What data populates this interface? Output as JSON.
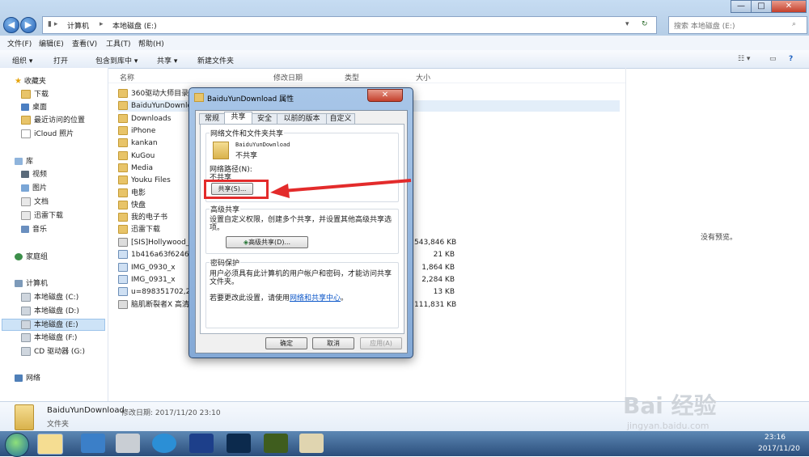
{
  "address": {
    "crumbs": [
      "计算机",
      "本地磁盘 (E:)"
    ],
    "search_placeholder": "搜索 本地磁盘 (E:)"
  },
  "window_controls": {
    "min": "—",
    "max": "□",
    "close": "✕"
  },
  "menu": [
    "文件(F)",
    "编辑(E)",
    "查看(V)",
    "工具(T)",
    "帮助(H)"
  ],
  "toolbar": [
    "组织 ▾",
    "打开",
    "包含到库中 ▾",
    "共享 ▾",
    "新建文件夹"
  ],
  "nav": {
    "favorites_title": "收藏夹",
    "favorites": [
      "下载",
      "桌面",
      "最近访问的位置",
      "iCloud 照片"
    ],
    "library_title": "库",
    "library": [
      "视频",
      "图片",
      "文档",
      "迅雷下载",
      "音乐"
    ],
    "homegroup": "家庭组",
    "computer_title": "计算机",
    "drives": [
      "本地磁盘 (C:)",
      "本地磁盘 (D:)",
      "本地磁盘 (E:)",
      "本地磁盘 (F:)",
      "CD 驱动器 (G:)"
    ],
    "network": "网络"
  },
  "columns": [
    "名称",
    "修改日期",
    "类型",
    "大小"
  ],
  "files": [
    {
      "name": "360驱动大师目录",
      "size": ""
    },
    {
      "name": "BaiduYunDownlo",
      "size": ""
    },
    {
      "name": "Downloads",
      "size": ""
    },
    {
      "name": "iPhone",
      "size": ""
    },
    {
      "name": "kankan",
      "size": ""
    },
    {
      "name": "KuGou",
      "size": ""
    },
    {
      "name": "Media",
      "size": ""
    },
    {
      "name": "Youku Files",
      "size": ""
    },
    {
      "name": "电影",
      "size": ""
    },
    {
      "name": "快盘",
      "size": ""
    },
    {
      "name": "我的电子书",
      "size": ""
    },
    {
      "name": "迅雷下载",
      "size": ""
    },
    {
      "name": "[SIS]Hollywood_",
      "size": "543,846 KB"
    },
    {
      "name": "1b416a63f6246b",
      "size": "21 KB"
    },
    {
      "name": "IMG_0930_x",
      "size": "1,864 KB"
    },
    {
      "name": "IMG_0931_x",
      "size": "2,284 KB"
    },
    {
      "name": "u=898351702,27",
      "size": "13 KB"
    },
    {
      "name": "脑肌断裂者X 高清",
      "size": "111,831 KB"
    }
  ],
  "preview_text": "没有预览。",
  "details": {
    "name": "BaiduYunDownload",
    "modified_label": "修改日期: 2017/11/20 23:10",
    "type": "文件夹"
  },
  "dialog": {
    "title": "BaiduYunDownload 属性",
    "tabs": [
      "常规",
      "共享",
      "安全",
      "以前的版本",
      "自定义"
    ],
    "net_share_title": "网络文件和文件夹共享",
    "folder_name": "BaiduYunDownload",
    "share_state": "不共享",
    "net_path_label": "网络路径(N):",
    "net_path_value": "不共享",
    "share_button": "共享(S)...",
    "adv_title": "高级共享",
    "adv_desc": "设置自定义权限，创建多个共享，并设置其他高级共享选项。",
    "adv_button": "高级共享(D)...",
    "pwd_title": "密码保护",
    "pwd_desc": "用户必须具有此计算机的用户帐户和密码，才能访问共享文件夹。",
    "pwd_change_prefix": "若要更改此设置，请使用",
    "pwd_link": "网络和共享中心",
    "pwd_change_suffix": "。",
    "ok": "确定",
    "cancel": "取消",
    "apply": "应用(A)"
  },
  "clock": {
    "time": "23:16",
    "date": "2017/11/20"
  },
  "watermark": {
    "brand": "Bai  经验",
    "url": "jingyan.baidu.com"
  },
  "colors": {
    "accent_red": "#e32b2b",
    "link": "#0b56c8"
  }
}
